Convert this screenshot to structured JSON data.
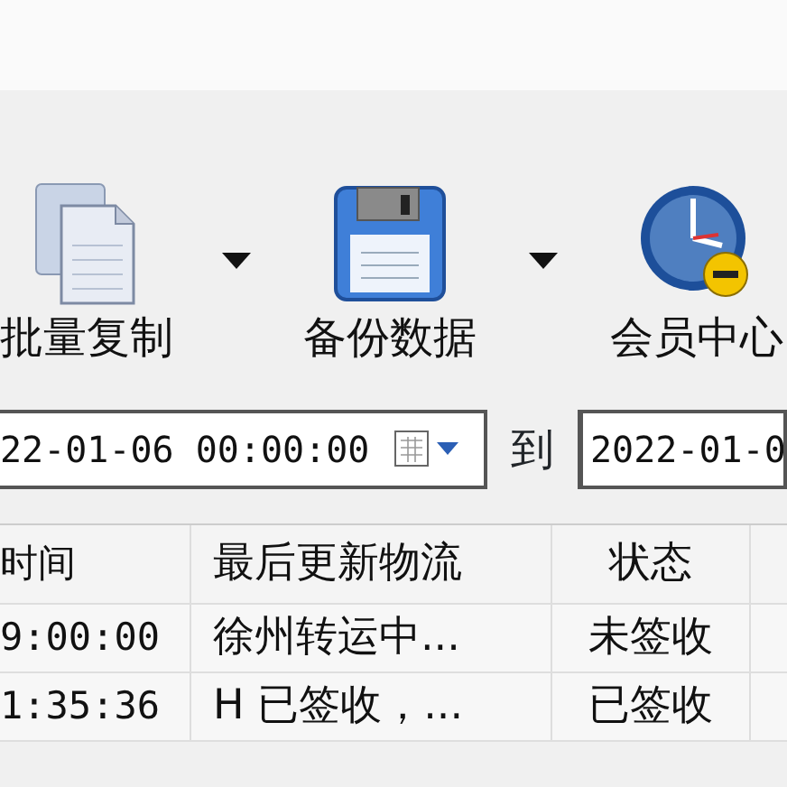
{
  "toolbar": [
    {
      "label": "批量复制",
      "has_menu": true
    },
    {
      "label": "备份数据",
      "has_menu": true
    },
    {
      "label": "会员中心",
      "has_menu": false
    }
  ],
  "date_range": {
    "from": "22-01-06 00:00:00",
    "separator": "到",
    "to": "2022-01-0"
  },
  "table": {
    "columns": [
      "时间",
      "最后更新物流",
      "状态"
    ],
    "rows": [
      [
        "9:00:00",
        "徐州转运中...",
        "未签收"
      ],
      [
        "1:35:36",
        "H 已签收，...",
        "已签收"
      ]
    ]
  }
}
